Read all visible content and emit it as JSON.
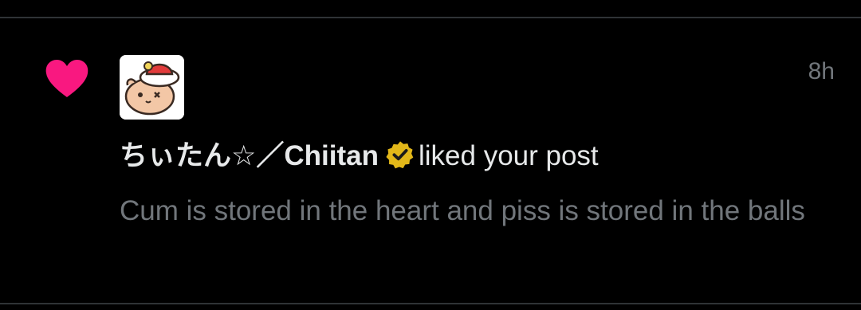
{
  "notification": {
    "type_icon": "heart-icon",
    "timestamp": "8h",
    "author_name": "ちぃたん☆／Chiitan",
    "verified_badge": "verified-gold-icon",
    "action_text": "liked your post",
    "post_excerpt": "Cum is stored in the heart and piss is stored in the balls",
    "avatar": "chiitan-avatar"
  },
  "colors": {
    "background": "#000000",
    "heart": "#f91880",
    "primary_text": "#e7e9ea",
    "secondary_text": "#71767b",
    "verified_gold": "#e2b719",
    "divider": "#2f3336"
  }
}
